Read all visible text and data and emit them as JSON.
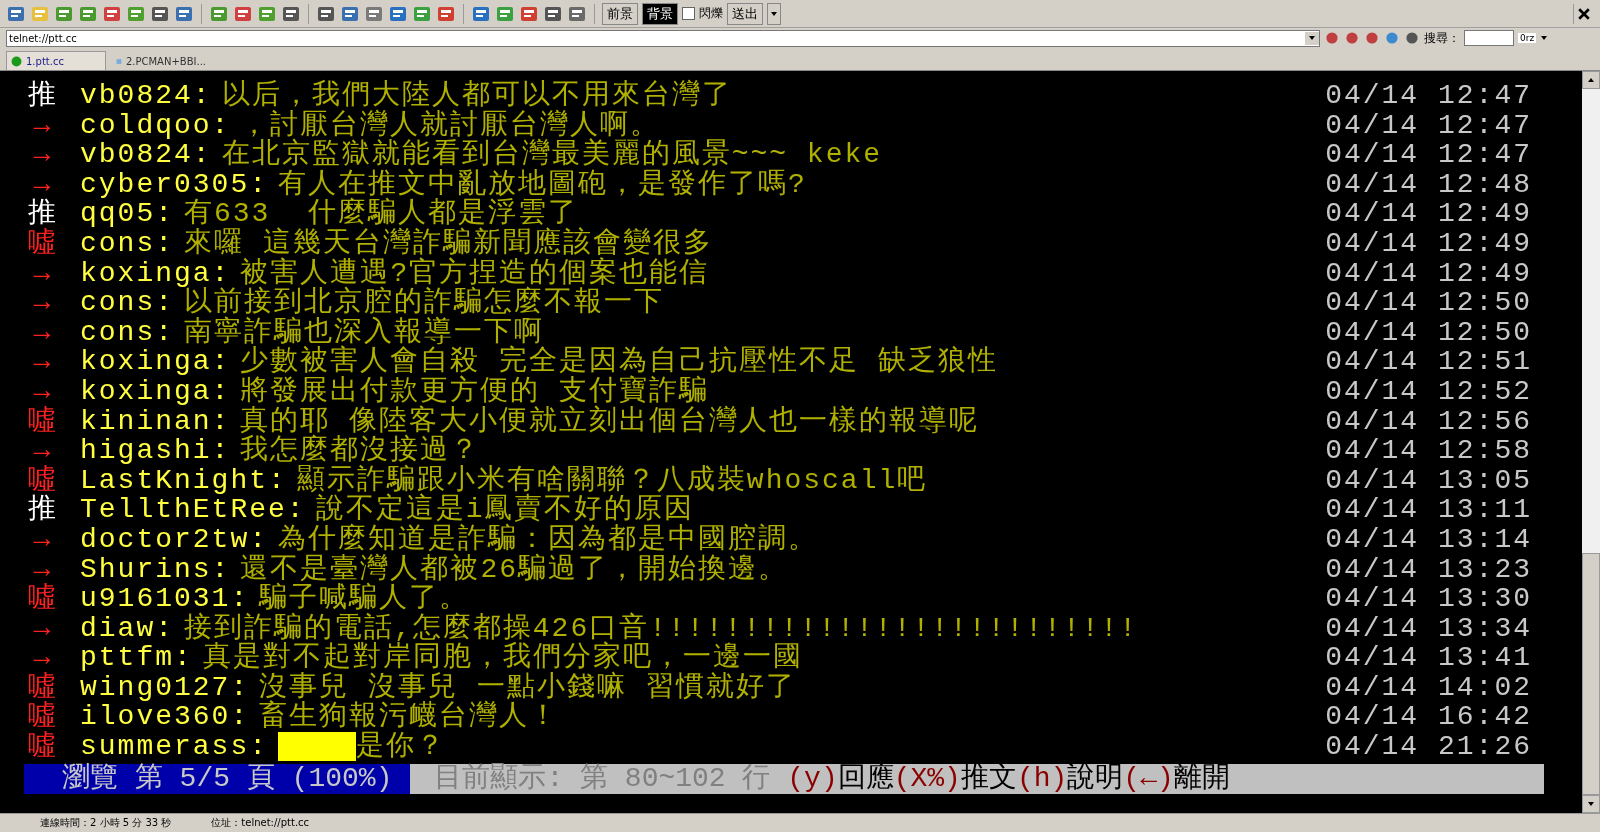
{
  "toolbar": {
    "buttons": [
      {
        "label": "前景",
        "selected": false
      },
      {
        "label": "背景",
        "selected": true
      }
    ],
    "blink": {
      "label": "閃爍",
      "checked": false
    },
    "send": "送出"
  },
  "address": {
    "value": "telnet://ptt.cc"
  },
  "search": {
    "label": "搜尋：",
    "engine": "0rz"
  },
  "tabs": [
    {
      "label": "1.ptt.cc",
      "selected": true
    },
    {
      "label": "2.PCMAN+BBI...",
      "selected": false
    }
  ],
  "rows": [
    {
      "kind": "push",
      "tag": "推",
      "user": "vb0824:",
      "content": "以后，我們大陸人都可以不用來台灣了",
      "time": "04/14 12:47"
    },
    {
      "kind": "arrow",
      "tag": "→",
      "user": "coldqoo:",
      "content": "，討厭台灣人就討厭台灣人啊。",
      "time": "04/14 12:47"
    },
    {
      "kind": "arrow",
      "tag": "→",
      "user": "vb0824:",
      "content": "在北京監獄就能看到台灣最美麗的風景~~~ keke",
      "time": "04/14 12:47"
    },
    {
      "kind": "arrow",
      "tag": "→",
      "user": "cyber0305:",
      "content": "有人在推文中亂放地圖砲，是發作了嗎?",
      "time": "04/14 12:48"
    },
    {
      "kind": "push",
      "tag": "推",
      "user": "qq05:",
      "content": "有633  什麼騙人都是浮雲了",
      "time": "04/14 12:49"
    },
    {
      "kind": "boo",
      "tag": "噓",
      "user": "cons:",
      "content": "來囉 這幾天台灣詐騙新聞應該會變很多",
      "time": "04/14 12:49"
    },
    {
      "kind": "arrow",
      "tag": "→",
      "user": "koxinga:",
      "content": "被害人遭遇?官方捏造的個案也能信",
      "time": "04/14 12:49"
    },
    {
      "kind": "arrow",
      "tag": "→",
      "user": "cons:",
      "content": "以前接到北京腔的詐騙怎麼不報一下",
      "time": "04/14 12:50"
    },
    {
      "kind": "arrow",
      "tag": "→",
      "user": "cons:",
      "content": "南寧詐騙也深入報導一下啊",
      "time": "04/14 12:50"
    },
    {
      "kind": "arrow",
      "tag": "→",
      "user": "koxinga:",
      "content": "少數被害人會自殺 完全是因為自己抗壓性不足 缺乏狼性",
      "time": "04/14 12:51"
    },
    {
      "kind": "arrow",
      "tag": "→",
      "user": "koxinga:",
      "content": "將發展出付款更方便的 支付寶詐騙",
      "time": "04/14 12:52"
    },
    {
      "kind": "boo",
      "tag": "噓",
      "user": "kininan:",
      "content": "真的耶 像陸客大小便就立刻出個台灣人也一樣的報導呢",
      "time": "04/14 12:56"
    },
    {
      "kind": "arrow",
      "tag": "→",
      "user": "higashi:",
      "content": "我怎麼都沒接過？",
      "time": "04/14 12:58"
    },
    {
      "kind": "boo",
      "tag": "噓",
      "user": "LastKnight:",
      "content": "顯示詐騙跟小米有啥關聯？八成裝whoscall吧",
      "time": "04/14 13:05"
    },
    {
      "kind": "push",
      "tag": "推",
      "user": "TellthEtRee:",
      "content": "說不定這是i鳳賣不好的原因",
      "time": "04/14 13:11"
    },
    {
      "kind": "arrow",
      "tag": "→",
      "user": "doctor2tw:",
      "content": "為什麼知道是詐騙：因為都是中國腔調。",
      "time": "04/14 13:14"
    },
    {
      "kind": "arrow",
      "tag": "→",
      "user": "Shurins:",
      "content": "還不是臺灣人都被26騙過了，開始換邊。",
      "time": "04/14 13:23"
    },
    {
      "kind": "boo",
      "tag": "噓",
      "user": "u9161031:",
      "content": "騙子喊騙人了。",
      "time": "04/14 13:30"
    },
    {
      "kind": "arrow",
      "tag": "→",
      "user": "diaw:",
      "content": "接到詐騙的電話,怎麼都操426口音!!!!!!!!!!!!!!!!!!!!!!!!!!",
      "time": "04/14 13:34"
    },
    {
      "kind": "arrow",
      "tag": "→",
      "user": "pttfm:",
      "content": "真是對不起對岸同胞，我們分家吧，一邊一國",
      "time": "04/14 13:41"
    },
    {
      "kind": "boo",
      "tag": "噓",
      "user": "wing0127:",
      "content": "沒事兒 沒事兒 一點小錢嘛 習慣就好了",
      "time": "04/14 14:02"
    },
    {
      "kind": "boo",
      "tag": "噓",
      "user": "ilove360:",
      "content": "畜生狗報污衊台灣人！",
      "time": "04/14 16:42"
    },
    {
      "kind": "boo",
      "tag": "噓",
      "user": "summerass:",
      "highlight_block": true,
      "content": "是你？",
      "time": "04/14 21:26"
    }
  ],
  "footer": {
    "page": "瀏覽 第 5/5 頁 (100%)",
    "parts": [
      {
        "kind": "info",
        "text": "目前顯示: 第 80~102 行 "
      },
      {
        "kind": "key",
        "text": "(y)"
      },
      {
        "kind": "label",
        "text": "回應"
      },
      {
        "kind": "key",
        "text": "(X%)"
      },
      {
        "kind": "label",
        "text": "推文"
      },
      {
        "kind": "key",
        "text": "(h)"
      },
      {
        "kind": "label",
        "text": "說明"
      },
      {
        "kind": "key",
        "text": "(←)"
      },
      {
        "kind": "label",
        "text": "離開"
      }
    ]
  },
  "status_bar": {
    "connection_time": "連線時間：2 小時 5 分 33 秒",
    "location": "位址：telnet://ptt.cc"
  }
}
